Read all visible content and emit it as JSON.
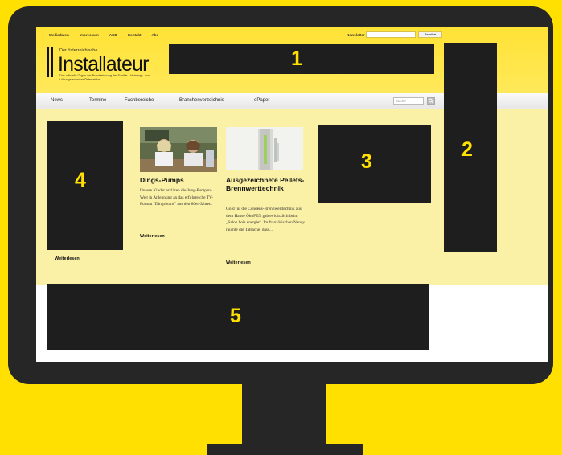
{
  "header": {
    "top_links": [
      "Mediadaten",
      "Impressum",
      "AGB",
      "Kontakt",
      "Abo"
    ],
    "newsletter_label": "Newsletter",
    "newsletter_button": "Senden",
    "logo_subtitle": "Der österreichische",
    "logo_title": "Installateur",
    "logo_tagline": "Das offizielle Organ der Bundesinnung der Sanitär-, Heizungs- und Lüftungstechniker Österreichs"
  },
  "nav": {
    "items": [
      "News",
      "Termine",
      "Fachbereiche",
      "Branchenverzeichnis",
      "ePaper"
    ],
    "search_placeholder": "Suche"
  },
  "articles": [
    {
      "title": "Dings-Pumps",
      "body": "Unsere Kinder erklären die Jung-Pumpen-Welt in Anlehnung an das erfolgreiche TV-Format \"Dingsbums\" aus den 80er-Jahren.",
      "more": "Weiterlesen"
    },
    {
      "title": "Ausgezeichnete Pellets-Brennwerttechnik",
      "body": "Gold für die Condens-Brennwerttechnik aus dem Hause ÖkoFEN gab es kürzlich beim „Salon bois energie“. Im französischen Nancy räumte die Tatsache, dass...",
      "more": "Weiterlesen"
    }
  ],
  "left_more": "Weiterlesen",
  "callouts": [
    "1",
    "2",
    "3",
    "4",
    "5"
  ],
  "colors": {
    "background": "#ffe000",
    "monitor": "#262626",
    "content": "#faf0a6",
    "callout": "#ffe000"
  }
}
